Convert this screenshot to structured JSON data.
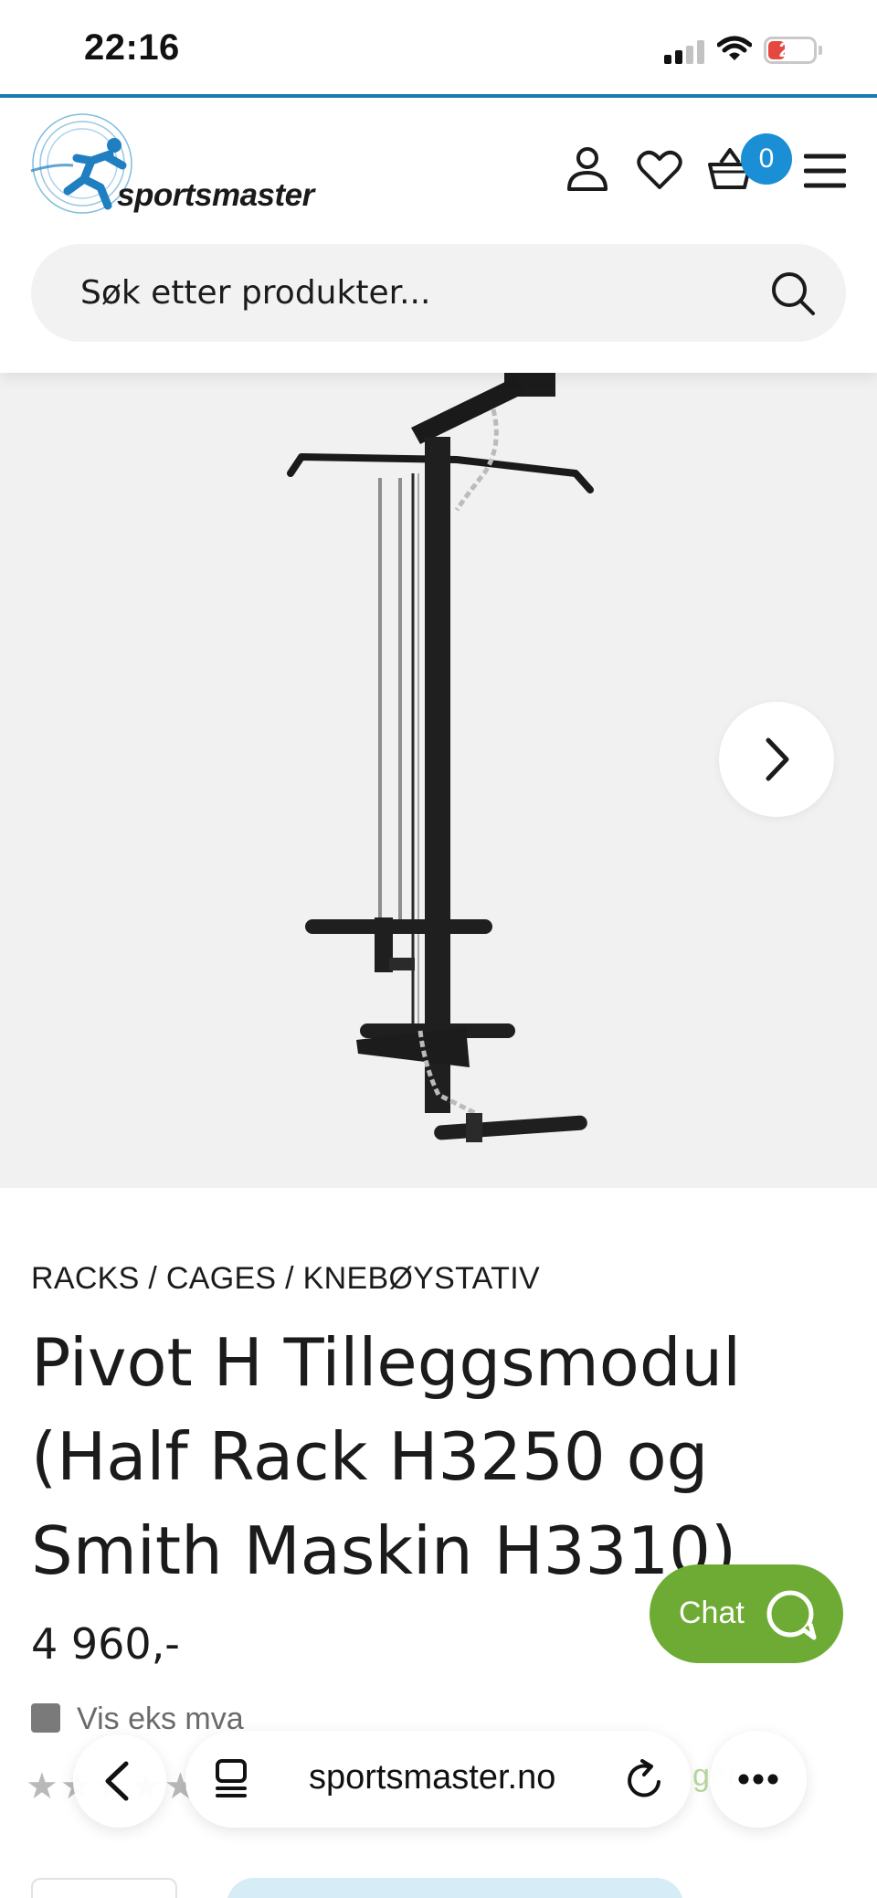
{
  "status_bar": {
    "time": "22:16",
    "battery": "20",
    "battery_color": "#e5483e"
  },
  "header": {
    "logo_text": "sportsmaster",
    "cart_count": "0",
    "accent_color": "#1a8fd6",
    "icons": [
      "user-icon",
      "heart-icon",
      "basket-icon",
      "menu-icon"
    ]
  },
  "search": {
    "placeholder": "Søk etter produkter...",
    "icon": "search-icon"
  },
  "gallery": {
    "next_icon": "chevron-right-icon"
  },
  "product": {
    "breadcrumb": "RACKS / CAGES / KNEBØYSTATIV",
    "title": "Pivot H Tilleggsmodul (Half Rack H3250 og Smith Maskin H3310)",
    "price": "4 960,-",
    "vat_label": "Vis eks mva",
    "rating_stars": "★★★★★",
    "stock_hint": "ger"
  },
  "chat": {
    "label": "Chat",
    "color": "#6eab34"
  },
  "browser": {
    "url": "sportsmaster.no",
    "back_icon": "chevron-left-icon",
    "tabs_icon": "tabs-icon",
    "reload_icon": "reload-icon",
    "more_icon": "more-icon"
  }
}
